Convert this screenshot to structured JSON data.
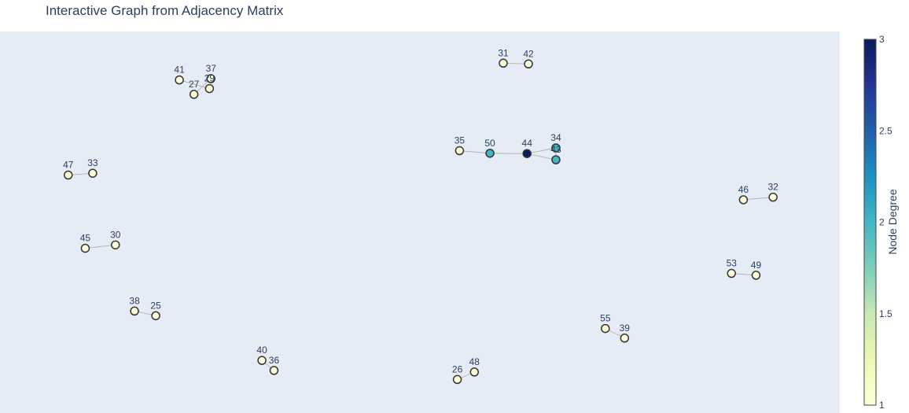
{
  "chart_data": {
    "type": "scatter",
    "title": "Interactive Graph from Adjacency Matrix",
    "colorbar": {
      "title": "Node Degree",
      "range": [
        1,
        3
      ],
      "ticks": [
        "1",
        "1.5",
        "2",
        "2.5",
        "3"
      ],
      "colorscale": [
        "#ffffd9",
        "#edf8b1",
        "#c7e9b4",
        "#7fcdbb",
        "#41b6c4",
        "#1d91c0",
        "#225ea8",
        "#253494",
        "#081d58"
      ]
    },
    "nodes": [
      {
        "id": "41",
        "x": 0.1953,
        "y": 0.8967,
        "degree": 1
      },
      {
        "id": "37",
        "x": 0.2353,
        "y": 0.9003,
        "degree": 1
      },
      {
        "id": "27",
        "x": 0.2138,
        "y": 0.8567,
        "degree": 1
      },
      {
        "id": "29",
        "x": 0.2334,
        "y": 0.8727,
        "degree": 1
      },
      {
        "id": "31",
        "x": 0.6056,
        "y": 0.9436,
        "degree": 1
      },
      {
        "id": "42",
        "x": 0.6375,
        "y": 0.9414,
        "degree": 1
      },
      {
        "id": "35",
        "x": 0.5502,
        "y": 0.6995,
        "degree": 1
      },
      {
        "id": "50",
        "x": 0.5887,
        "y": 0.6923,
        "degree": 2
      },
      {
        "id": "44",
        "x": 0.6357,
        "y": 0.6914,
        "degree": 3
      },
      {
        "id": "34",
        "x": 0.6723,
        "y": 0.7074,
        "degree": 2
      },
      {
        "id": "43",
        "x": 0.6723,
        "y": 0.6741,
        "degree": 2
      },
      {
        "id": "47",
        "x": 0.0545,
        "y": 0.6315,
        "degree": 1
      },
      {
        "id": "33",
        "x": 0.0855,
        "y": 0.6366,
        "degree": 1
      },
      {
        "id": "46",
        "x": 0.9098,
        "y": 0.5626,
        "degree": 1
      },
      {
        "id": "32",
        "x": 0.9474,
        "y": 0.5699,
        "degree": 1
      },
      {
        "id": "45",
        "x": 0.0761,
        "y": 0.4274,
        "degree": 1
      },
      {
        "id": "30",
        "x": 0.1143,
        "y": 0.4368,
        "degree": 1
      },
      {
        "id": "53",
        "x": 0.8947,
        "y": 0.3573,
        "degree": 1
      },
      {
        "id": "49",
        "x": 0.9258,
        "y": 0.3522,
        "degree": 1
      },
      {
        "id": "38",
        "x": 0.1385,
        "y": 0.2524,
        "degree": 1
      },
      {
        "id": "25",
        "x": 0.1654,
        "y": 0.2393,
        "degree": 1
      },
      {
        "id": "55",
        "x": 0.7349,
        "y": 0.2037,
        "degree": 1
      },
      {
        "id": "39",
        "x": 0.7593,
        "y": 0.1769,
        "degree": 1
      },
      {
        "id": "40",
        "x": 0.2999,
        "y": 0.1147,
        "degree": 1
      },
      {
        "id": "36",
        "x": 0.3152,
        "y": 0.0868,
        "degree": 1
      },
      {
        "id": "26",
        "x": 0.5474,
        "y": 0.0615,
        "degree": 1
      },
      {
        "id": "48",
        "x": 0.569,
        "y": 0.0823,
        "degree": 1
      }
    ],
    "edges": [
      [
        "41",
        "29"
      ],
      [
        "37",
        "27"
      ],
      [
        "31",
        "42"
      ],
      [
        "35",
        "50"
      ],
      [
        "50",
        "44"
      ],
      [
        "44",
        "34"
      ],
      [
        "44",
        "43"
      ],
      [
        "34",
        "43"
      ],
      [
        "47",
        "33"
      ],
      [
        "46",
        "32"
      ],
      [
        "45",
        "30"
      ],
      [
        "53",
        "49"
      ],
      [
        "38",
        "25"
      ],
      [
        "55",
        "39"
      ],
      [
        "40",
        "36"
      ],
      [
        "26",
        "48"
      ]
    ]
  }
}
